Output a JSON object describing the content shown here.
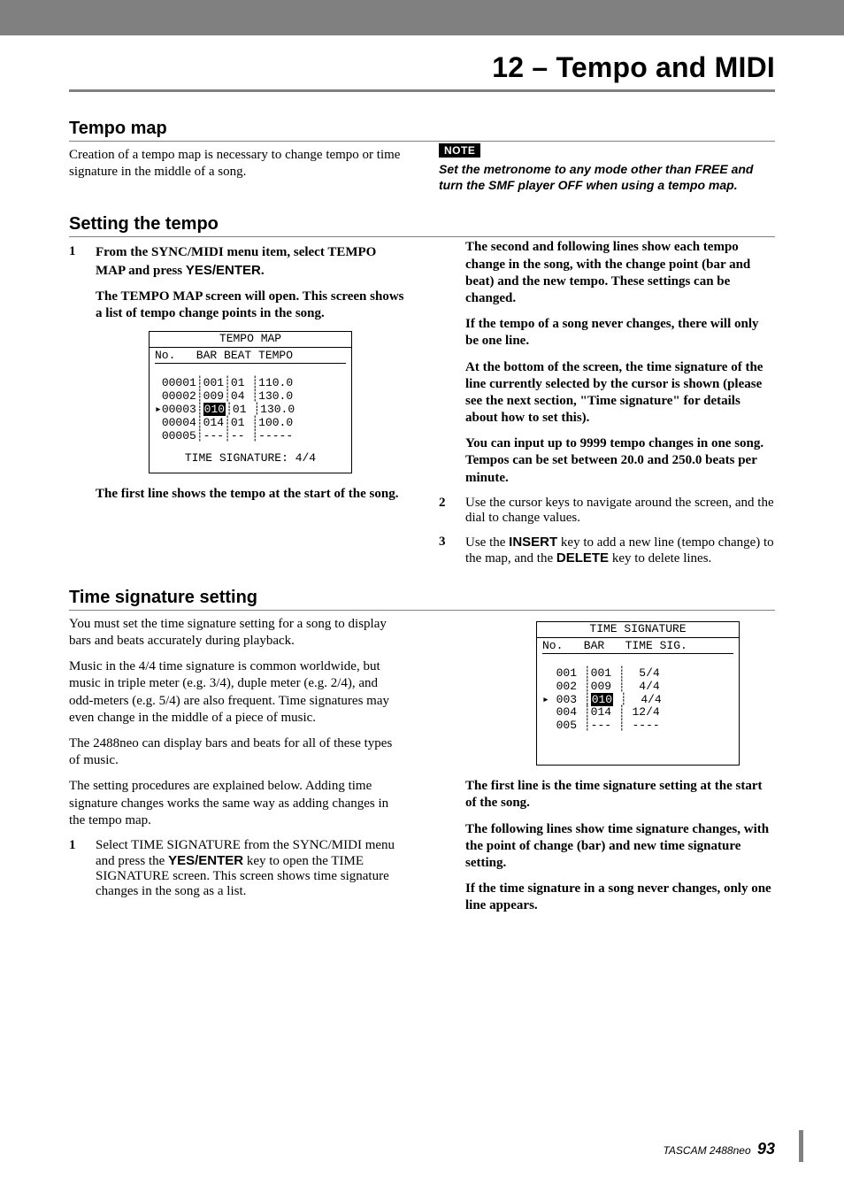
{
  "chapter": {
    "title": "12 – Tempo and MIDI"
  },
  "sections": {
    "tempo_map": {
      "heading": "Tempo map",
      "para": "Creation of a tempo map is necessary to change tempo or time signature in the middle of a song.",
      "note_label": "NOTE",
      "note_body": "Set the metronome to any mode other than FREE and turn the SMF player OFF when using a tempo map."
    },
    "setting_tempo": {
      "heading": "Setting the tempo",
      "step1a": "From the SYNC/MIDI menu item, select TEMPO MAP and press ",
      "yes_enter": "YES/ENTER",
      "step1a_end": ".",
      "step1b": "The TEMPO MAP screen will open. This screen shows a list of tempo change points in the song.",
      "caption": "The first line shows the tempo at the start of the song.",
      "right": {
        "p1": "The second and following lines show each tempo change in the song, with the change point (bar and beat) and the new tempo. These settings can be changed.",
        "p2": "If the tempo of a song never changes, there will only be one line.",
        "p3": "At the bottom of the screen, the time signature of the line currently selected by the cursor is shown (please see the next section, \"Time signature\" for details about how to set this).",
        "p4": "You can input up to 9999 tempo changes in one song. Tempos can be set between 20.0 and 250.0 beats per minute."
      },
      "step2": "Use the cursor keys to navigate around the screen, and the dial to change values.",
      "step3a": "Use the ",
      "insert": "INSERT",
      "step3b": " key to add a new line (tempo change) to the map, and the ",
      "delete": "DELETE",
      "step3c": " key to delete lines."
    },
    "time_sig": {
      "heading": "Time signature setting",
      "p1": "You must set the time signature setting for a song to display bars and beats accurately during playback.",
      "p2": "Music in the 4/4 time signature is common worldwide, but music in triple meter (e.g. 3/4), duple meter (e.g. 2/4), and odd-meters (e.g. 5/4) are also frequent. Time signatures may even change in the middle of a piece of music.",
      "p3": "The 2488neo can display bars and beats for all of these types of music.",
      "p4": "The setting procedures are explained below. Adding time signature changes works the same way as adding changes in the tempo map.",
      "step1a": "Select TIME SIGNATURE from the SYNC/MIDI menu and press the ",
      "yes_enter": "YES/ENTER",
      "step1b": " key to open the TIME SIGNATURE screen. This screen shows time signature changes in the song as a list.",
      "right": {
        "p1": "The first line is the time signature setting at the start of the song.",
        "p2": "The following lines show time signature changes, with the point of change (bar) and new time signature setting.",
        "p3": "If the time signature in a song never changes, only one line appears."
      }
    }
  },
  "lcd1": {
    "title": "TEMPO MAP",
    "header": "No.   BAR BEAT TEMPO",
    "rows": [
      {
        "no": "00001",
        "bar": "001",
        "beat": "01",
        "tempo": "110.0",
        "sel": false
      },
      {
        "no": "00002",
        "bar": "009",
        "beat": "04",
        "tempo": "130.0",
        "sel": false
      },
      {
        "no": "00003",
        "bar": "010",
        "beat": "01",
        "tempo": "130.0",
        "sel": true
      },
      {
        "no": "00004",
        "bar": "014",
        "beat": "01",
        "tempo": "100.0",
        "sel": false
      },
      {
        "no": "00005",
        "bar": "---",
        "beat": "--",
        "tempo": "-----",
        "sel": false
      }
    ],
    "footer": "TIME SIGNATURE: 4/4"
  },
  "lcd2": {
    "title": "TIME SIGNATURE",
    "header": "No.   BAR   TIME SIG.",
    "rows": [
      {
        "no": "001",
        "bar": "001",
        "sig": " 5/4",
        "sel": false
      },
      {
        "no": "002",
        "bar": "009",
        "sig": " 4/4",
        "sel": false
      },
      {
        "no": "003",
        "bar": "010",
        "sig": " 4/4",
        "sel": true
      },
      {
        "no": "004",
        "bar": "014",
        "sig": "12/4",
        "sel": false
      },
      {
        "no": "005",
        "bar": "---",
        "sig": "----",
        "sel": false
      }
    ]
  },
  "footer": {
    "product": "TASCAM  2488neo",
    "page": "93"
  }
}
